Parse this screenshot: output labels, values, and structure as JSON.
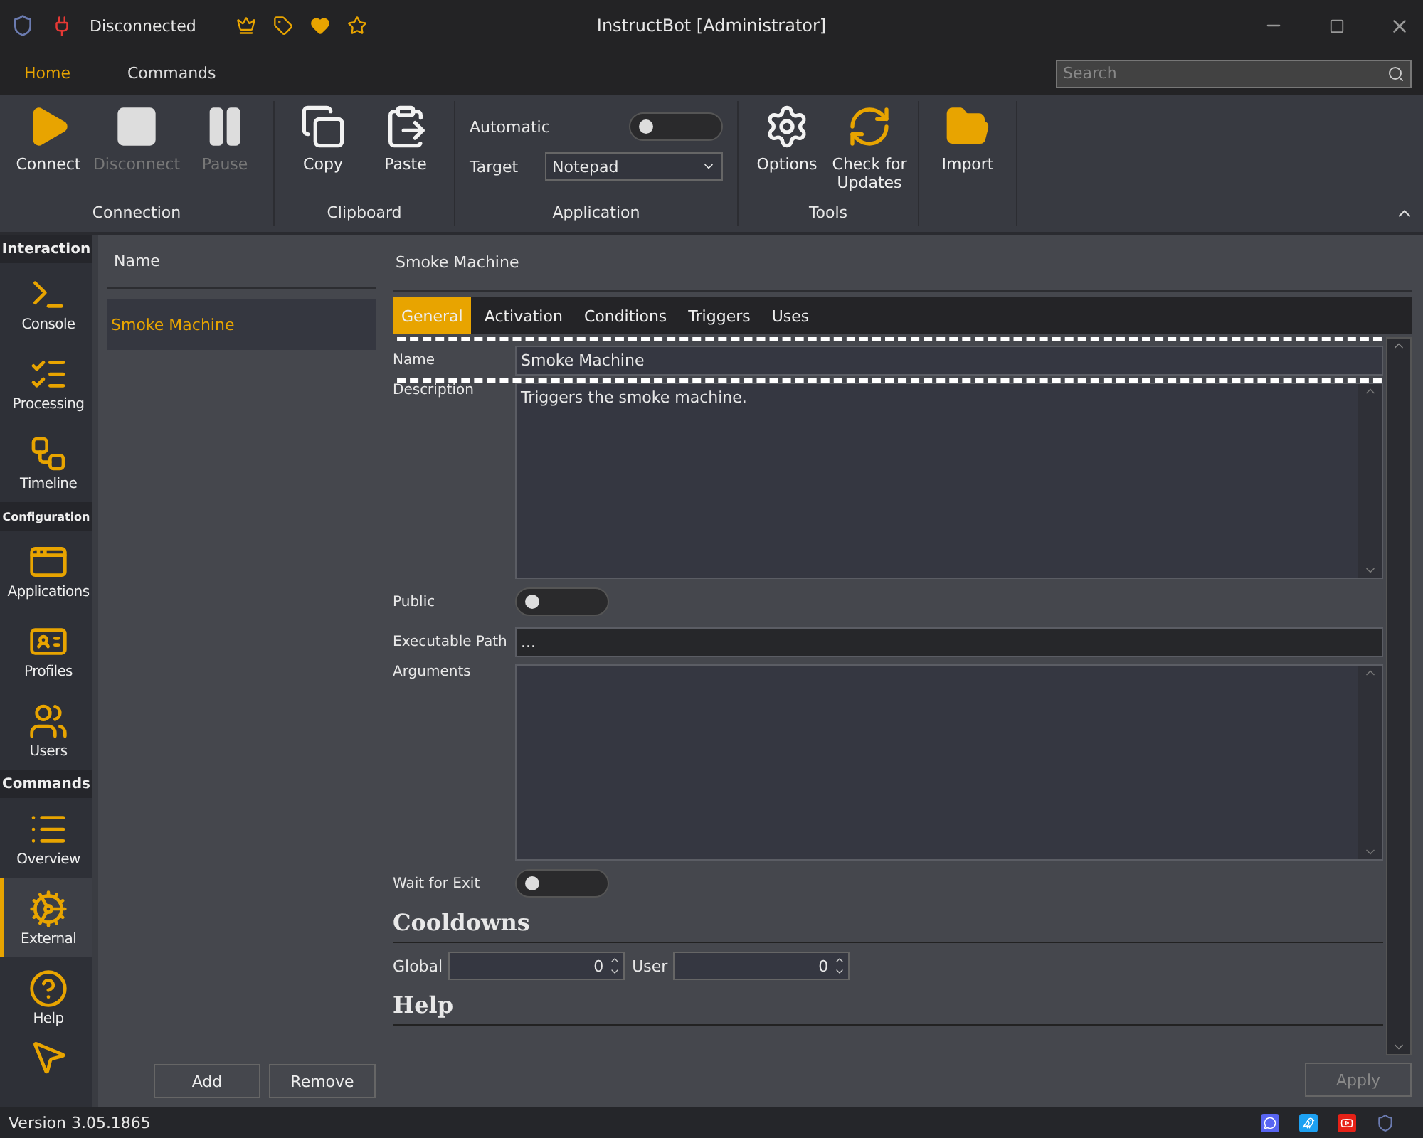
{
  "title_bar": {
    "status": "Disconnected",
    "title": "InstructBot [Administrator]"
  },
  "menu_tabs": [
    {
      "label": "Home",
      "selected": true
    },
    {
      "label": "Commands",
      "selected": false
    }
  ],
  "search": {
    "placeholder": "Search"
  },
  "ribbon": [
    {
      "kind": "buttons",
      "label": "Connection",
      "items": [
        {
          "label": "Connect",
          "disabled": false
        },
        {
          "label": "Disconnect",
          "disabled": true
        },
        {
          "label": "Pause",
          "disabled": true
        }
      ]
    },
    {
      "kind": "buttons",
      "label": "Clipboard",
      "items": [
        {
          "label": "Copy",
          "disabled": false
        },
        {
          "label": "Paste",
          "disabled": false
        }
      ]
    },
    {
      "kind": "settings",
      "label": "Application",
      "toggle_label": "Automatic",
      "toggle_on": false,
      "select_label": "Target",
      "select_value": "Notepad"
    },
    {
      "kind": "buttons",
      "label": "Tools",
      "items": [
        {
          "label": "Options",
          "disabled": false
        },
        {
          "label": "Check for Updates",
          "disabled": false
        }
      ]
    },
    {
      "kind": "buttons",
      "items": [
        {
          "label": "Import",
          "disabled": false
        }
      ]
    }
  ],
  "sidebar": [
    {
      "title": "Interaction",
      "items": [
        {
          "label": "Console",
          "selected": false
        },
        {
          "label": "Processing",
          "selected": false
        },
        {
          "label": "Timeline",
          "selected": false
        }
      ]
    },
    {
      "title": "Configuration",
      "items": [
        {
          "label": "Applications",
          "selected": false
        },
        {
          "label": "Profiles",
          "selected": false
        },
        {
          "label": "Users",
          "selected": false
        }
      ]
    },
    {
      "title": "Commands",
      "items": [
        {
          "label": "Overview",
          "selected": false
        },
        {
          "label": "External",
          "selected": true
        },
        {
          "label": "Help",
          "selected": false
        },
        {
          "selected": false
        }
      ]
    }
  ],
  "list": {
    "header": "Name",
    "rows": [
      {
        "label": "Smoke Machine",
        "selected": true
      }
    ],
    "buttons": [
      "Add",
      "Remove"
    ]
  },
  "detail": {
    "title": "Smoke Machine",
    "tabs": [
      {
        "label": "General",
        "selected": true
      },
      {
        "label": "Activation",
        "selected": false
      },
      {
        "label": "Conditions",
        "selected": false
      },
      {
        "label": "Triggers",
        "selected": false
      },
      {
        "label": "Uses",
        "selected": false
      }
    ],
    "fields": [
      {
        "kind": "text",
        "label": "Name",
        "value": "Smoke Machine",
        "highlighted": true
      },
      {
        "kind": "textarea",
        "label": "Description",
        "value": "Triggers the smoke machine."
      },
      {
        "kind": "toggle",
        "label": "Public",
        "on": false
      },
      {
        "kind": "path",
        "label": "Executable Path",
        "value": "..."
      },
      {
        "kind": "textarea",
        "label": "Arguments"
      },
      {
        "kind": "toggle",
        "label": "Wait for Exit",
        "on": false
      },
      {
        "kind": "heading",
        "label": "Cooldowns"
      },
      {
        "kind": "spinners",
        "items": [
          {
            "label": "Global",
            "value": "0"
          },
          {
            "label": "User",
            "value": "0"
          }
        ]
      },
      {
        "kind": "heading",
        "label": "Help"
      }
    ],
    "apply": {
      "label": "Apply",
      "disabled": true
    }
  },
  "status_bar": {
    "version": "Version 3.05.1865"
  }
}
